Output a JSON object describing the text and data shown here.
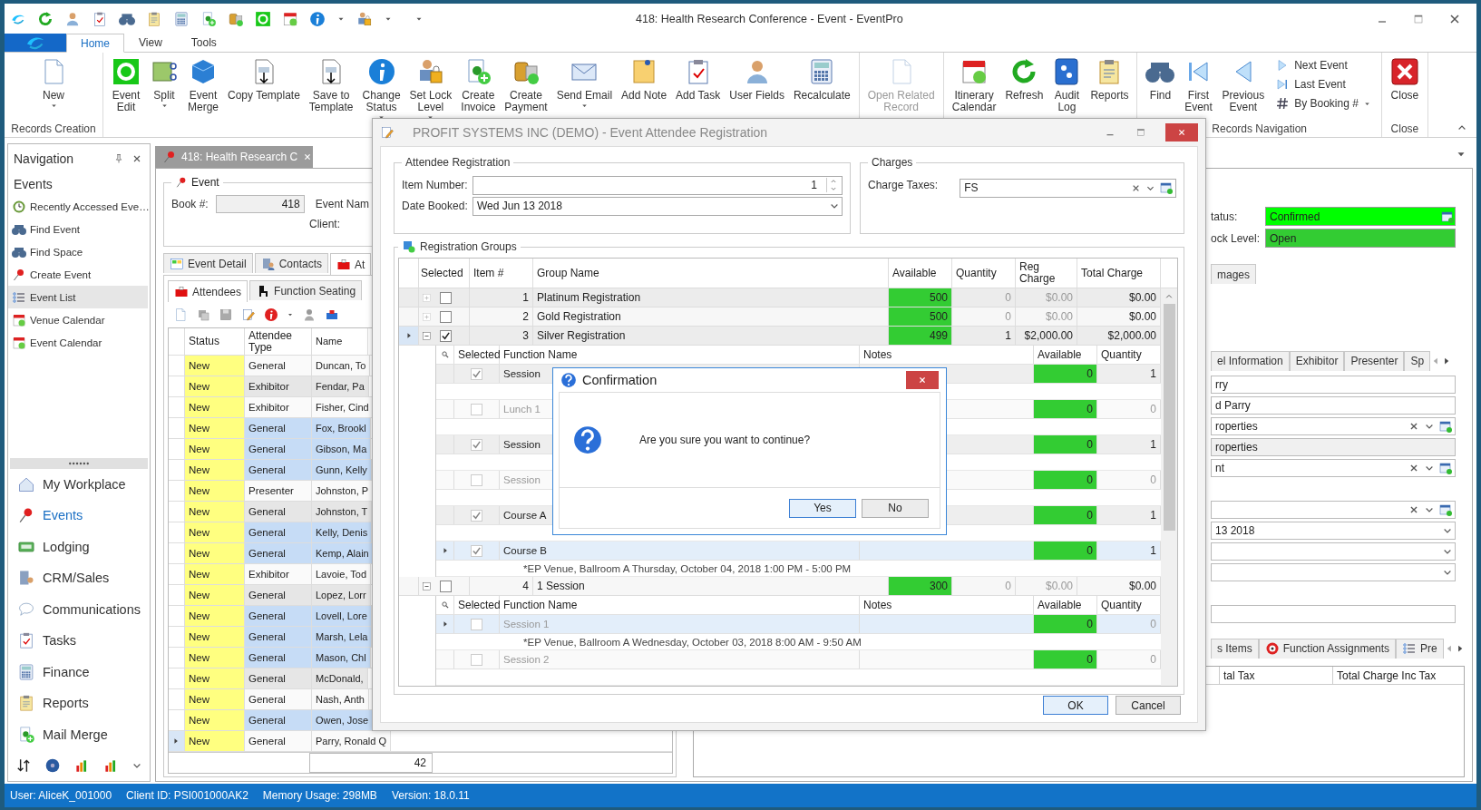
{
  "window": {
    "title": "418: Health Research Conference - Event - EventPro"
  },
  "ribbon_tabs": [
    {
      "label": "Home",
      "selected": true
    },
    {
      "label": "View",
      "selected": false
    },
    {
      "label": "Tools",
      "selected": false
    }
  ],
  "ribbon_groups": [
    {
      "label": "Records Creation",
      "buttons": [
        {
          "label": "New",
          "dropdown": true,
          "disabled": false
        }
      ]
    },
    {
      "buttons": [
        {
          "label": "Event\nEdit",
          "dropdown": false,
          "disabled": false
        },
        {
          "label": "Split",
          "dropdown": true,
          "disabled": false
        },
        {
          "label": "Event\nMerge",
          "dropdown": false,
          "disabled": false
        },
        {
          "label": "Copy Template",
          "dropdown": false,
          "disabled": false
        },
        {
          "label": "Save to\nTemplate",
          "dropdown": false,
          "disabled": false
        },
        {
          "label": "Change\nStatus",
          "dropdown": true,
          "disabled": false
        },
        {
          "label": "Set Lock\nLevel",
          "dropdown": true,
          "disabled": false
        },
        {
          "label": "Create\nInvoice",
          "dropdown": false,
          "disabled": false
        },
        {
          "label": "Create\nPayment",
          "dropdown": false,
          "disabled": false
        },
        {
          "label": "Send Email",
          "dropdown": true,
          "disabled": false
        },
        {
          "label": "Add Note",
          "dropdown": false,
          "disabled": false
        },
        {
          "label": "Add Task",
          "dropdown": false,
          "disabled": false
        },
        {
          "label": "User Fields",
          "dropdown": false,
          "disabled": false
        },
        {
          "label": "Recalculate",
          "dropdown": false,
          "disabled": false
        }
      ]
    },
    {
      "buttons": [
        {
          "label": "Open Related\nRecord",
          "dropdown": false,
          "disabled": true
        }
      ]
    },
    {
      "buttons": [
        {
          "label": "Itinerary\nCalendar",
          "dropdown": false,
          "disabled": false
        },
        {
          "label": "Refresh",
          "dropdown": false,
          "disabled": false
        },
        {
          "label": "Audit\nLog",
          "dropdown": false,
          "disabled": false
        },
        {
          "label": "Reports",
          "dropdown": false,
          "disabled": false
        }
      ]
    },
    {
      "label": "Records Navigation",
      "buttons": [
        {
          "label": "Find",
          "dropdown": false,
          "disabled": false
        },
        {
          "label": "First\nEvent",
          "dropdown": false,
          "disabled": false
        },
        {
          "label": "Previous\nEvent",
          "dropdown": false,
          "disabled": false
        }
      ],
      "small_buttons": [
        {
          "label": "Next Event",
          "dropdown": false
        },
        {
          "label": "Last Event",
          "dropdown": false
        },
        {
          "label": "By Booking #",
          "dropdown": true
        }
      ]
    },
    {
      "label": "Close",
      "buttons": [
        {
          "label": "Close",
          "dropdown": false,
          "disabled": false
        }
      ]
    }
  ],
  "navigation": {
    "title": "Navigation",
    "section": "Events",
    "items": [
      {
        "label": "Recently Accessed Eve…",
        "selected": false
      },
      {
        "label": "Find Event",
        "selected": false
      },
      {
        "label": "Find Space",
        "selected": false
      },
      {
        "label": "Create Event",
        "selected": false
      },
      {
        "label": "Event List",
        "selected": true
      },
      {
        "label": "Venue Calendar",
        "selected": false
      },
      {
        "label": "Event Calendar",
        "selected": false
      }
    ],
    "modules": [
      {
        "label": "My Workplace",
        "selected": false
      },
      {
        "label": "Events",
        "selected": true
      },
      {
        "label": "Lodging",
        "selected": false
      },
      {
        "label": "CRM/Sales",
        "selected": false
      },
      {
        "label": "Communications",
        "selected": false
      },
      {
        "label": "Tasks",
        "selected": false
      },
      {
        "label": "Finance",
        "selected": false
      },
      {
        "label": "Reports",
        "selected": false
      },
      {
        "label": "Mail Merge",
        "selected": false
      }
    ]
  },
  "document_tab": {
    "label": "418: Health Research C"
  },
  "event": {
    "title": "Event",
    "book_label": "Book #:",
    "book": "418",
    "event_name_label": "Event Nam",
    "client_label": "Client:"
  },
  "tabs": [
    {
      "label": "Event Detail",
      "selected": false
    },
    {
      "label": "Contacts",
      "selected": false
    },
    {
      "label": "At",
      "selected": true
    }
  ],
  "sub_tabs": [
    {
      "label": "Attendees",
      "selected": true
    },
    {
      "label": "Function Seating",
      "selected": false
    }
  ],
  "attendees": {
    "columns": [
      "Status",
      "Attendee\nType",
      "Name"
    ],
    "rows": [
      {
        "status": "New",
        "type": "General",
        "name": "Duncan, To",
        "selected": false,
        "current": false
      },
      {
        "status": "New",
        "type": "Exhibitor",
        "name": "Fendar, Pa",
        "selected": false,
        "current": false
      },
      {
        "status": "New",
        "type": "Exhibitor",
        "name": "Fisher, Cind",
        "selected": false,
        "current": false
      },
      {
        "status": "New",
        "type": "General",
        "name": "Fox, Brookl",
        "selected": true,
        "current": false
      },
      {
        "status": "New",
        "type": "General",
        "name": "Gibson, Ma",
        "selected": true,
        "current": false
      },
      {
        "status": "New",
        "type": "General",
        "name": "Gunn, Kelly",
        "selected": true,
        "current": false
      },
      {
        "status": "New",
        "type": "Presenter",
        "name": "Johnston, P",
        "selected": false,
        "current": false
      },
      {
        "status": "New",
        "type": "General",
        "name": "Johnston, T",
        "selected": false,
        "current": false
      },
      {
        "status": "New",
        "type": "General",
        "name": "Kelly, Denis",
        "selected": true,
        "current": false
      },
      {
        "status": "New",
        "type": "General",
        "name": "Kemp, Alain",
        "selected": true,
        "current": false
      },
      {
        "status": "New",
        "type": "Exhibitor",
        "name": "Lavoie, Tod",
        "selected": false,
        "current": false
      },
      {
        "status": "New",
        "type": "General",
        "name": "Lopez, Lorr",
        "selected": false,
        "current": false
      },
      {
        "status": "New",
        "type": "General",
        "name": "Lovell, Lore",
        "selected": true,
        "current": false
      },
      {
        "status": "New",
        "type": "General",
        "name": "Marsh, Lela",
        "selected": true,
        "current": false
      },
      {
        "status": "New",
        "type": "General",
        "name": "Mason, Chl",
        "selected": true,
        "current": false
      },
      {
        "status": "New",
        "type": "General",
        "name": "McDonald,",
        "selected": false,
        "current": false
      },
      {
        "status": "New",
        "type": "General",
        "name": "Nash, Anth",
        "selected": false,
        "current": false
      },
      {
        "status": "New",
        "type": "General",
        "name": "Owen, Jose",
        "selected": true,
        "current": false
      },
      {
        "status": "New",
        "type": "General",
        "name": "Parry, Ronald Q",
        "selected": false,
        "current": true
      }
    ],
    "count": "42"
  },
  "detail": {
    "status_label": "tatus:",
    "status": "Confirmed",
    "lock_label": "ock Level:",
    "lock": "Open",
    "top_tabs": [
      {
        "label": "mages",
        "selected": false
      }
    ],
    "tabs": [
      {
        "label": "el Information",
        "selected": false
      },
      {
        "label": "Exhibitor",
        "selected": false
      },
      {
        "label": "Presenter",
        "selected": false
      },
      {
        "label": "Sp",
        "selected": false
      }
    ],
    "fields": [
      {
        "kind": "text",
        "value": "rry"
      },
      {
        "kind": "text",
        "value": "d Parry"
      },
      {
        "kind": "lookup",
        "value": "roperties"
      },
      {
        "kind": "readonly",
        "value": "roperties"
      },
      {
        "kind": "lookup",
        "value": "nt"
      },
      {
        "kind": "gap"
      },
      {
        "kind": "lookup"
      },
      {
        "kind": "dropdown",
        "value": "13 2018"
      },
      {
        "kind": "dropdown"
      },
      {
        "kind": "dropdown"
      },
      {
        "kind": "gap"
      },
      {
        "kind": "text"
      }
    ],
    "bottom_tabs": [
      {
        "label": "s Items",
        "selected": false
      },
      {
        "label": "Function Assignments",
        "selected": false
      },
      {
        "label": "Pre",
        "selected": false
      }
    ],
    "grid_columns": [
      "tal Tax",
      "Total Charge Inc Tax"
    ]
  },
  "registration": {
    "title": "PROFIT SYSTEMS INC (DEMO) - Event Attendee Registration",
    "attendee_group": "Attendee Registration",
    "item_number_label": "Item Number:",
    "item_number": "1",
    "date_label": "Date Booked:",
    "date": "Wed Jun 13 2018",
    "charges_group": "Charges",
    "charge_taxes_label": "Charge Taxes:",
    "charge_taxes": "FS",
    "groups_title": "Registration Groups",
    "columns": [
      "Selected",
      "Item #",
      "Group Name",
      "Available",
      "Quantity",
      "Reg Charge",
      "Total Charge"
    ],
    "groups": [
      {
        "item": "1",
        "name": "Platinum Registration",
        "available": "500",
        "quantity": "0",
        "reg_charge": "$0.00",
        "total_charge": "$0.00",
        "selected": false,
        "expanded": false,
        "current": false
      },
      {
        "item": "2",
        "name": "Gold Registration",
        "available": "500",
        "quantity": "0",
        "reg_charge": "$0.00",
        "total_charge": "$0.00",
        "selected": false,
        "expanded": false,
        "current": false
      },
      {
        "item": "3",
        "name": "Silver Registration",
        "available": "499",
        "quantity": "1",
        "reg_charge": "$2,000.00",
        "total_charge": "$2,000.00",
        "selected": true,
        "expanded": true,
        "current": true,
        "function_columns": [
          "Selected",
          "Function Name",
          "Notes",
          "Available",
          "Quantity"
        ],
        "functions": [
          {
            "name": "Session",
            "selected": true,
            "available": "0",
            "quantity": "1",
            "current": false
          },
          {
            "name": "Lunch 1",
            "selected": false,
            "available": "0",
            "quantity": "0",
            "current": false
          },
          {
            "name": "Session",
            "selected": true,
            "available": "0",
            "quantity": "1",
            "current": false
          },
          {
            "name": "Session",
            "selected": false,
            "available": "0",
            "quantity": "0",
            "current": false
          },
          {
            "name": "Course A",
            "selected": true,
            "available": "0",
            "quantity": "1",
            "current": false
          },
          {
            "name": "Course B",
            "selected": true,
            "available": "0",
            "quantity": "1",
            "current": true,
            "venue": "*EP Venue, Ballroom A Thursday, October 04, 2018 1:00 PM - 5:00 PM"
          }
        ]
      },
      {
        "item": "4",
        "name": "1 Session",
        "available": "300",
        "quantity": "0",
        "reg_charge": "$0.00",
        "total_charge": "$0.00",
        "selected": false,
        "expanded": true,
        "current": false,
        "function_columns": [
          "Selected",
          "Function Name",
          "Notes",
          "Available",
          "Quantity"
        ],
        "functions": [
          {
            "name": "Session 1",
            "selected": false,
            "available": "0",
            "quantity": "0",
            "current": true,
            "venue": "*EP Venue, Ballroom A Wednesday, October 03, 2018 8:00 AM - 9:50 AM"
          },
          {
            "name": "Session 2",
            "selected": false,
            "available": "0",
            "quantity": "0",
            "current": false
          }
        ]
      }
    ],
    "buttons": [
      {
        "label": "OK",
        "focused": true
      },
      {
        "label": "Cancel",
        "focused": false
      }
    ]
  },
  "confirmation": {
    "title": "Confirmation",
    "message": "Are you sure you want to continue?",
    "buttons": [
      {
        "label": "Yes",
        "focused": true
      },
      {
        "label": "No",
        "focused": false
      }
    ]
  },
  "status_bar": [
    "User: AliceK_001000",
    "Client ID: PSI001000AK2",
    "Memory Usage: 298MB",
    "Version: 18.0.11"
  ]
}
